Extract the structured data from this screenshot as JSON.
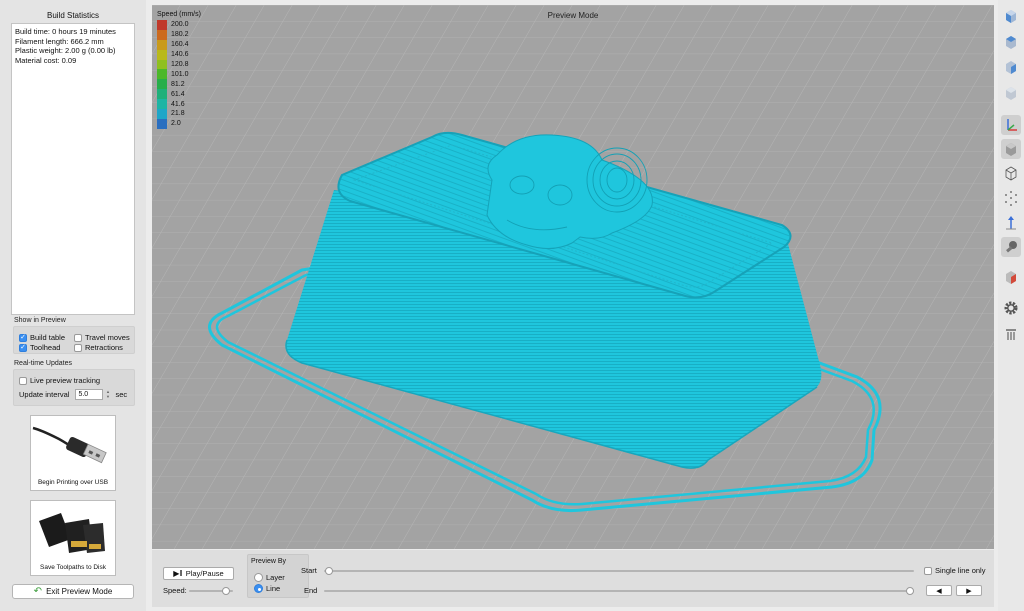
{
  "left_panel": {
    "title": "Build Statistics",
    "stats": [
      "Build time: 0 hours 19 minutes",
      "Filament length: 666.2 mm",
      "Plastic weight: 2.00 g (0.00 lb)",
      "Material cost: 0.09"
    ],
    "show_in_preview": {
      "label": "Show in Preview",
      "build_table": "Build table",
      "travel_moves": "Travel moves",
      "toolhead": "Toolhead",
      "retractions": "Retractions"
    },
    "realtime": {
      "label": "Real-time Updates",
      "live_tracking": "Live preview tracking",
      "interval_label": "Update interval",
      "interval_value": "5.0",
      "unit": "sec"
    },
    "usb_caption": "Begin Printing over USB",
    "sd_caption": "Save Toolpaths to Disk",
    "exit_button": "Exit Preview Mode"
  },
  "viewport": {
    "mode_label": "Preview Mode",
    "legend_title": "Speed (mm/s)",
    "legend": [
      {
        "value": "200.0",
        "color": "#c0392b"
      },
      {
        "value": "180.2",
        "color": "#cc6a1e"
      },
      {
        "value": "160.4",
        "color": "#c99a1a"
      },
      {
        "value": "140.6",
        "color": "#b9b91a"
      },
      {
        "value": "120.8",
        "color": "#8fc01f"
      },
      {
        "value": "101.0",
        "color": "#4cb82a"
      },
      {
        "value": "81.2",
        "color": "#27ae4a"
      },
      {
        "value": "61.4",
        "color": "#1fb07a"
      },
      {
        "value": "41.6",
        "color": "#1db5a4"
      },
      {
        "value": "21.8",
        "color": "#1ea6c8"
      },
      {
        "value": "2.0",
        "color": "#2a6fc0"
      }
    ],
    "print_color": "#1fc6dd"
  },
  "controls": {
    "play_pause": "Play/Pause",
    "speed_label": "Speed:",
    "preview_by": "Preview By",
    "layer": "Layer",
    "line": "Line",
    "start": "Start",
    "end": "End",
    "single_line_only": "Single line only",
    "prev": "◀",
    "next": "▶"
  },
  "toolbar_icons": [
    "view-front-icon",
    "view-top-icon",
    "view-right-icon",
    "view-iso-icon",
    "axes-icon",
    "solid-view-icon",
    "wireframe-icon",
    "points-icon",
    "axis-z-icon",
    "magnet-icon",
    "cube-red-icon",
    "gear-icon",
    "layers-icon"
  ]
}
